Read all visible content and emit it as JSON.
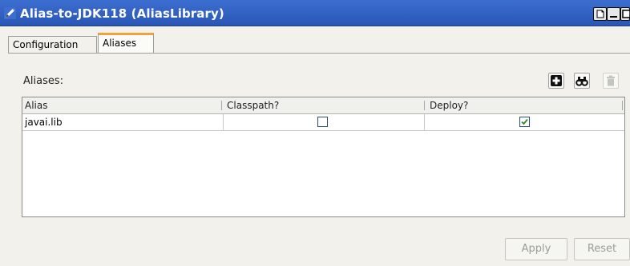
{
  "window": {
    "title": "Alias-to-JDK118 (AliasLibrary)",
    "colors": {
      "titlebar": "#2f5fc4",
      "accent_tab": "#f0a33c",
      "background": "#f2f1ec"
    },
    "buttons": [
      "restore-icon",
      "minimize-icon",
      "maximize-icon"
    ]
  },
  "tabs": [
    {
      "label": "Configuration",
      "selected": false
    },
    {
      "label": "Aliases",
      "selected": true
    }
  ],
  "section": {
    "label": "Aliases:",
    "toolbar": [
      {
        "name": "add-icon",
        "enabled": true
      },
      {
        "name": "find-icon",
        "enabled": true
      },
      {
        "name": "delete-icon",
        "enabled": false
      }
    ]
  },
  "table": {
    "columns": [
      "Alias",
      "Classpath?",
      "Deploy?"
    ],
    "rows": [
      {
        "alias": "javai.lib",
        "classpath": false,
        "deploy": true
      }
    ]
  },
  "footer": {
    "apply_label": "Apply",
    "reset_label": "Reset",
    "apply_enabled": false,
    "reset_enabled": false
  }
}
